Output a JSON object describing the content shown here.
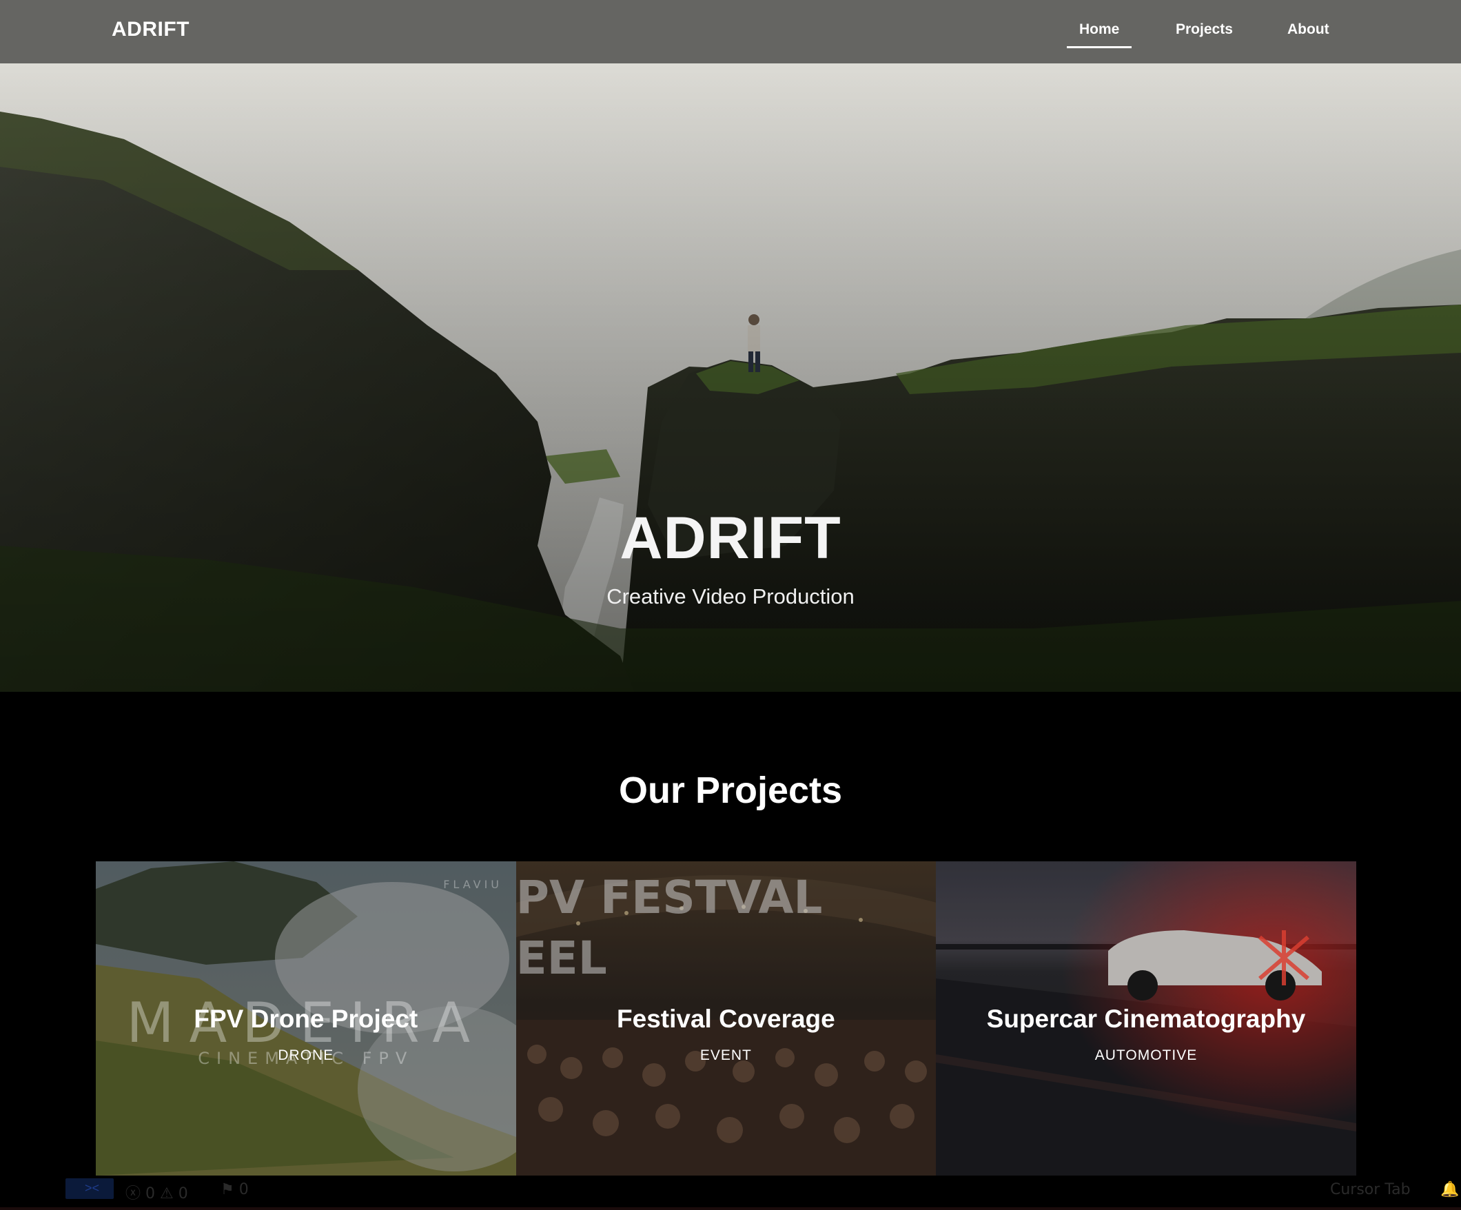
{
  "nav": {
    "brand": "ADRIFT",
    "links": [
      {
        "label": "Home",
        "active": true
      },
      {
        "label": "Projects",
        "active": false
      },
      {
        "label": "About",
        "active": false
      }
    ]
  },
  "hero": {
    "title": "ADRIFT",
    "subtitle": "Creative Video Production"
  },
  "projects": {
    "heading": "Our Projects",
    "cards": [
      {
        "title": "FPV Drone Project",
        "category": "DRONE",
        "watermark_main": "MADEIRA",
        "watermark_sub": "CINEMATIC FPV",
        "watermark_corner": "FLAVIU"
      },
      {
        "title": "Festival Coverage",
        "category": "EVENT",
        "watermark_line1": "PV FESTVAL",
        "watermark_line2": "EEL"
      },
      {
        "title": "Supercar Cinematography",
        "category": "AUTOMOTIVE"
      }
    ]
  },
  "status_bar": {
    "problems": "ⓧ 0 ⚠ 0",
    "ports": "⚑ 0",
    "right_label": "Cursor Tab"
  },
  "colors": {
    "nav_bg": "#656562",
    "page_bg": "#000000",
    "text": "#ffffff"
  },
  "icons": [
    "remote-icon",
    "error-icon",
    "warning-icon",
    "ports-icon",
    "bell-icon"
  ]
}
